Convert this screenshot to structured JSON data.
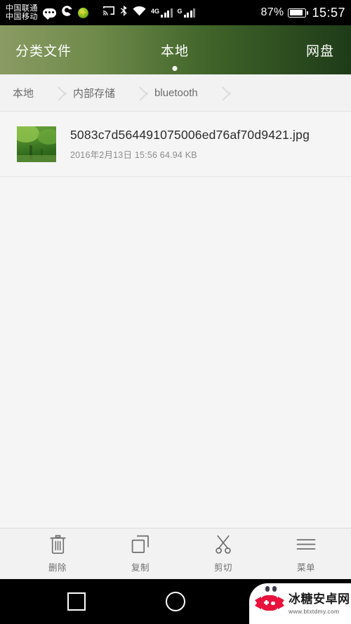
{
  "statusbar": {
    "carrier_line1": "中国联通",
    "carrier_line2": "中国移动",
    "icons": [
      "message-bubble-icon",
      "browser-icon",
      "globe-icon",
      "cast-icon",
      "bluetooth-icon",
      "wifi-icon"
    ],
    "network_4g_label": "4G",
    "network_g_label": "G",
    "battery_percent": "87%",
    "clock": "15:57"
  },
  "tabs": [
    {
      "label": "分类文件",
      "selected": false
    },
    {
      "label": "本地",
      "selected": true
    },
    {
      "label": "网盘",
      "selected": false
    }
  ],
  "breadcrumb": {
    "items": [
      "本地",
      "内部存储",
      "bluetooth"
    ]
  },
  "files": [
    {
      "name": "5083c7d564491075006ed76af70d9421.jpg",
      "meta": "2016年2月13日 15:56 64.94 KB",
      "thumb": "forest-image-thumbnail"
    }
  ],
  "toolbar": [
    {
      "label": "删除",
      "icon": "trash-icon"
    },
    {
      "label": "复制",
      "icon": "copy-icon"
    },
    {
      "label": "剪切",
      "icon": "scissors-icon"
    },
    {
      "label": "菜单",
      "icon": "menu-icon"
    }
  ],
  "navbar": {
    "recents": "square-recents-icon",
    "home": "circle-home-icon"
  },
  "watermark": {
    "name": "冰糖安卓网",
    "url": "www.btxtdmy.com"
  },
  "colors": {
    "tab_gradient_start": "#8a9b63",
    "tab_gradient_end": "#1e3b18",
    "content_bg": "#f5f5f5",
    "statusbar_bg": "#000000",
    "watermark_red": "#e8123c"
  }
}
